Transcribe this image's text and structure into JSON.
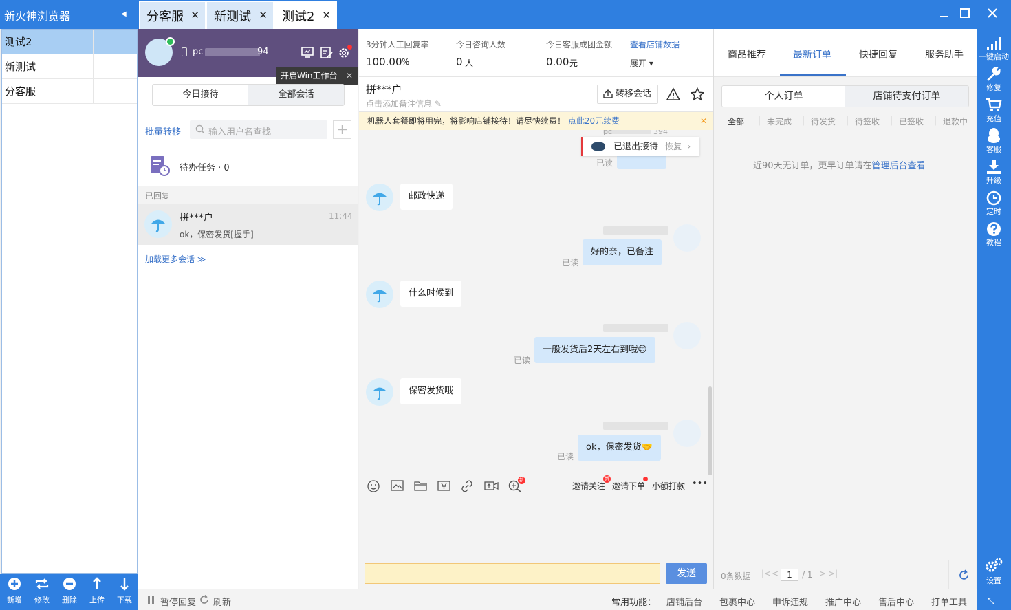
{
  "app": {
    "title": "新火神浏览器"
  },
  "tabs": [
    {
      "label": "分客服",
      "active": false
    },
    {
      "label": "新测试",
      "active": false
    },
    {
      "label": "测试2",
      "active": true
    }
  ],
  "window_controls": {
    "minimize": "—",
    "maximize": "☐",
    "close": "✕"
  },
  "accounts": [
    {
      "name": "测试2",
      "selected": true
    },
    {
      "name": "新测试",
      "selected": false
    },
    {
      "name": "分客服",
      "selected": false
    }
  ],
  "left_toolbar": {
    "add": "新增",
    "modify": "修改",
    "delete": "删除",
    "upload": "上传",
    "download": "下载"
  },
  "shop": {
    "name_prefix": "pc",
    "name_suffix": "94",
    "tooltip": "开启Win工作台"
  },
  "conv_tabs": {
    "today": "今日接待",
    "all": "全部会话"
  },
  "conv_tools": {
    "batch_transfer": "批量转移",
    "search_placeholder": "输入用户名查找"
  },
  "todo": {
    "label": "待办任务 · 0"
  },
  "replied_section": "已回复",
  "conversations": [
    {
      "name": "拼***户",
      "time": "11:44",
      "preview": "ok，保密发货[握手]"
    }
  ],
  "load_more": "加载更多会话 ≫",
  "stats": {
    "reply_rate_label": "3分钟人工回复率",
    "reply_rate_value": "100.00",
    "reply_rate_unit": "%",
    "consult_label": "今日咨询人数",
    "consult_value": "0",
    "consult_unit": "人",
    "gmv_label": "今日客服成团金额",
    "gmv_value": "0.00",
    "gmv_unit": "元",
    "view_data_link": "查看店铺数据",
    "expand": "展开"
  },
  "chat_header": {
    "customer": "拼***户",
    "note_hint": "点击添加备注信息",
    "transfer_button": "转移会话"
  },
  "notice": {
    "text": "机器人套餐即将用完，将影响店铺接待！请尽快续费！",
    "link": "点此20元续费"
  },
  "robot_status": {
    "text": "已退出接待",
    "action": "恢复"
  },
  "read_label": "已读",
  "messages": [
    {
      "from": "customer",
      "text": "邮政快递"
    },
    {
      "from": "me",
      "text": "好的亲，已备注"
    },
    {
      "from": "customer",
      "text": "什么时候到"
    },
    {
      "from": "me",
      "text": "一般发货后2天左右到哦😊"
    },
    {
      "from": "customer",
      "text": "保密发货哦"
    },
    {
      "from": "me",
      "text": "ok，保密发货🤝"
    }
  ],
  "chat_tools": {
    "invite_follow": "邀请关注",
    "invite_order": "邀请下单",
    "small_pay": "小额打款",
    "more": "•••"
  },
  "send_button": "发送",
  "right_tabs": [
    {
      "label": "商品推荐",
      "active": false
    },
    {
      "label": "最新订单",
      "active": true
    },
    {
      "label": "快捷回复",
      "active": false
    },
    {
      "label": "服务助手",
      "active": false
    }
  ],
  "order_tabs": {
    "personal": "个人订单",
    "shop_pending": "店铺待支付订单"
  },
  "order_filters": [
    "全部",
    "未完成",
    "待发货",
    "待签收",
    "已签收",
    "退款中"
  ],
  "order_empty": {
    "text": "近90天无订单，更早订单请在",
    "link": "管理后台查看"
  },
  "pagination": {
    "count": "0条数据",
    "page": "1",
    "total": "/ 1"
  },
  "far_right": [
    "一键启动",
    "修复",
    "充值",
    "客服",
    "升级",
    "定时",
    "教程",
    "设置"
  ],
  "bottom_bar": {
    "pause": "暂停回复",
    "refresh": "刷新",
    "common_label": "常用功能：",
    "links": [
      "店铺后台",
      "包裹中心",
      "申诉违规",
      "推广中心",
      "售后中心",
      "打单工具"
    ]
  },
  "colors": {
    "primary": "#2f7fe0",
    "shop_header": "#5f4f7e",
    "notice_bg": "#fdf5d9",
    "bubble_me": "#d4e8fb"
  }
}
